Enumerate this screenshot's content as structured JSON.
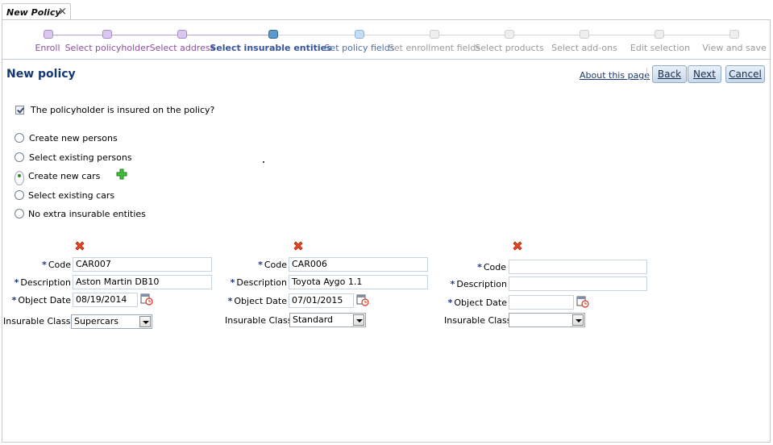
{
  "tab": {
    "title": "New Policy",
    "close": "×"
  },
  "train": {
    "steps": [
      {
        "label": "Enroll",
        "state": "visited"
      },
      {
        "label": "Select policyholder",
        "state": "visited"
      },
      {
        "label": "Select address",
        "state": "visited"
      },
      {
        "label": "Select insurable entities",
        "state": "current"
      },
      {
        "label": "Set policy fields",
        "state": "next"
      },
      {
        "label": "Set enrollment fields",
        "state": "future"
      },
      {
        "label": "Select products",
        "state": "future"
      },
      {
        "label": "Select add-ons",
        "state": "future"
      },
      {
        "label": "Edit selection",
        "state": "future"
      },
      {
        "label": "View and save",
        "state": "future"
      }
    ]
  },
  "header": {
    "title": "New policy",
    "about_link": "About this page",
    "back": "Back",
    "next": "Next",
    "cancel": "Cancel"
  },
  "policyholder_insured": {
    "label": "The policyholder is insured on the policy?",
    "checked": true
  },
  "options": [
    {
      "label": "Create new  persons",
      "selected": false
    },
    {
      "label": "Select existing persons",
      "selected": false
    },
    {
      "label": "Create new cars",
      "selected": true
    },
    {
      "label": "Select existing cars",
      "selected": false
    },
    {
      "label": "No extra insurable entities",
      "selected": false
    }
  ],
  "form_labels": {
    "code": "Code",
    "description": "Description",
    "object_date": "Object Date",
    "insurable_class": "Insurable Class",
    "required_marker": "*"
  },
  "cars": [
    {
      "code": "CAR007",
      "description": "Aston Martin DB10",
      "object_date": "08/19/2014",
      "insurable_class": "Supercars"
    },
    {
      "code": "CAR006",
      "description": "Toyota Aygo 1.1",
      "object_date": "07/01/2015",
      "insurable_class": "Standard"
    },
    {
      "code": "",
      "description": "",
      "object_date": "",
      "insurable_class": ""
    }
  ],
  "colors": {
    "visited": "#8a4d9e",
    "current": "#35549b",
    "future": "#9a9a9a",
    "title": "#153870",
    "delete": "#d8331a",
    "add": "#2aa52a"
  }
}
